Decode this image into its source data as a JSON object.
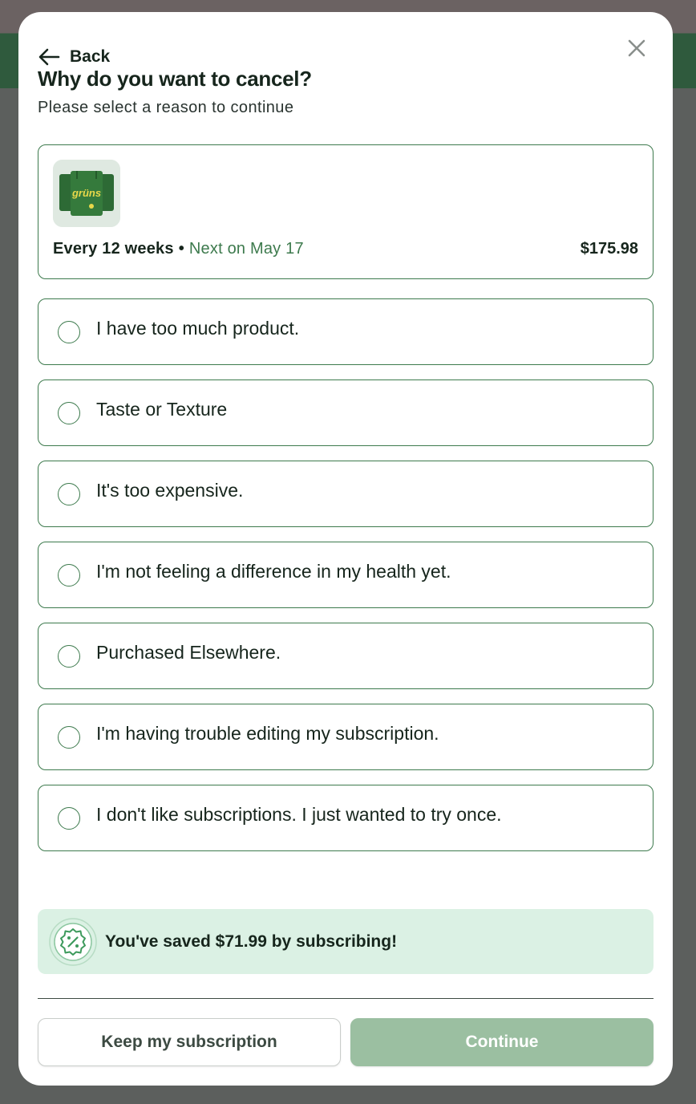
{
  "header": {
    "back_label": "Back",
    "title": "Why do you want to cancel?",
    "subtitle": "Please select a reason to continue"
  },
  "subscription": {
    "product_brand_text": "grüns",
    "frequency": "Every 12 weeks",
    "separator": "•",
    "next_label": "Next on May 17",
    "price": "$175.98"
  },
  "reasons": [
    {
      "label": "I have too much product.",
      "selected": false
    },
    {
      "label": "Taste or Texture",
      "selected": false
    },
    {
      "label": "It's too expensive.",
      "selected": false
    },
    {
      "label": "I'm not feeling a difference in my health yet.",
      "selected": false
    },
    {
      "label": "Purchased Elsewhere.",
      "selected": false
    },
    {
      "label": "I'm having trouble editing my subscription.",
      "selected": false
    },
    {
      "label": "I don't like subscriptions. I just wanted to try once.",
      "selected": false
    }
  ],
  "savings": {
    "icon": "discount-badge-icon",
    "message": "You've saved $71.99 by subscribing!"
  },
  "actions": {
    "keep_label": "Keep my subscription",
    "continue_label": "Continue",
    "continue_enabled": false
  },
  "colors": {
    "brand_green": "#3d7a4d",
    "savings_bg": "#dbf1e4",
    "continue_disabled": "#9bbfa1",
    "text_dark": "#16251c"
  }
}
